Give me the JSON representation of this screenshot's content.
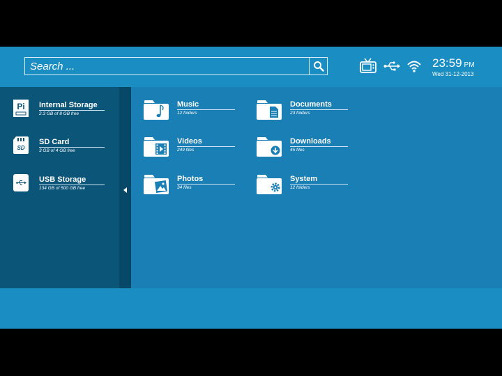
{
  "search": {
    "placeholder": "Search ..."
  },
  "status": {
    "icons": [
      "tv-icon",
      "usb-icon",
      "wifi-icon"
    ]
  },
  "clock": {
    "time": "23:59",
    "ampm": "PM",
    "date": "Wed  31-12-2013"
  },
  "sidebar": {
    "items": [
      {
        "icon": "raspberry-pi-icon",
        "icon_text": "Pi",
        "label": "Internal Storage",
        "sub": "2.3 GB of 8 GB free"
      },
      {
        "icon": "sd-card-icon",
        "icon_text": "SD",
        "label": "SD Card",
        "sub": "3 GB of 4 GB free"
      },
      {
        "icon": "usb-drive-icon",
        "label": "USB Storage",
        "sub": "134 GB of 500 GB free"
      }
    ]
  },
  "folders": [
    {
      "icon": "music-folder-icon",
      "label": "Music",
      "sub": "12 folders"
    },
    {
      "icon": "documents-folder-icon",
      "label": "Documents",
      "sub": "23 folders"
    },
    {
      "icon": "videos-folder-icon",
      "label": "Videos",
      "sub": "249 files"
    },
    {
      "icon": "downloads-folder-icon",
      "label": "Downloads",
      "sub": "45 files"
    },
    {
      "icon": "photos-folder-icon",
      "label": "Photos",
      "sub": "34 files"
    },
    {
      "icon": "system-folder-icon",
      "label": "System",
      "sub": "12 folders"
    }
  ],
  "colors": {
    "background": "#1a7fb4",
    "bar": "#1a8dc2",
    "sidebar": "#0b5579",
    "collapse_strip": "#074767",
    "text": "#ffffff"
  }
}
